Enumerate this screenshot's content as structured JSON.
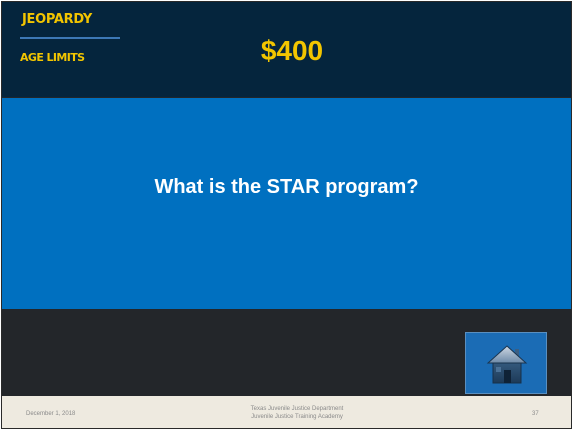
{
  "header": {
    "brand_top": "JEOPARDY",
    "brand_bottom": "AGE LIMITS",
    "value": "$400"
  },
  "question": {
    "text": "What is the STAR program?"
  },
  "home_button": {
    "icon": "home-icon"
  },
  "footer": {
    "date": "December 1, 2018",
    "line1": "Texas Juvenile Justice Department",
    "line2": "Juvenile Justice Training Academy",
    "page_number": "37"
  },
  "colors": {
    "header_bg": "#05253d",
    "accent_yellow": "#f2c500",
    "question_bg": "#0070c0",
    "lower_bg": "#23262a",
    "footer_bg": "#eeeae0",
    "home_button_bg": "#1b6cb5"
  }
}
